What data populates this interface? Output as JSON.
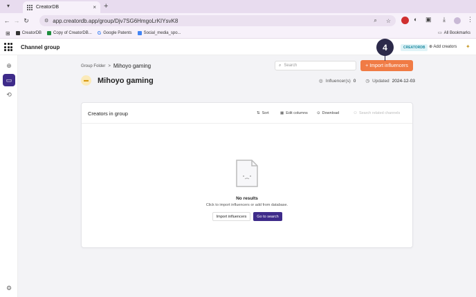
{
  "browser": {
    "tab_title": "CreatorDB",
    "url": "app.creatordb.app/group/Djv7SG6HmgoLrKIYsvK8",
    "bookmarks": [
      {
        "label": "CreatorDB",
        "icon": "creatordb-icon",
        "color": "#333333"
      },
      {
        "label": "Copy of CreatorDB...",
        "icon": "sheets-icon",
        "color": "#1e8e3e"
      },
      {
        "label": "Google Patents",
        "icon": "google-icon",
        "color": "#4285f4"
      },
      {
        "label": "Social_media_spo...",
        "icon": "docs-icon",
        "color": "#4285f4"
      }
    ],
    "all_bookmarks": "All Bookmarks"
  },
  "app": {
    "page_title": "Channel group",
    "badge": "CREATORDB",
    "add_creators": "Add creators"
  },
  "breadcrumb": {
    "parent": "Group Folder",
    "separator": ">",
    "current": "Mihoyo gaming"
  },
  "search": {
    "placeholder": "Search"
  },
  "import_button": "+ Import influencers",
  "step_marker": "4",
  "group": {
    "title": "Mihoyo gaming",
    "influencers_label": "Influencer(s)",
    "influencers_count": "0",
    "updated_label": "Updated",
    "updated_date": "2024-12-03"
  },
  "card": {
    "title": "Creators in group",
    "tools": {
      "sort": "Sort",
      "edit_columns": "Edit columns",
      "download": "Download",
      "search_related": "Search related channels"
    },
    "empty": {
      "title": "No results",
      "subtitle": "Click to import influencers or add from database.",
      "import_button": "Import influencers",
      "search_button": "Go to search"
    }
  },
  "colors": {
    "accent": "#3e2b8a",
    "import": "#f07b45",
    "step": "#2c2a4a"
  }
}
